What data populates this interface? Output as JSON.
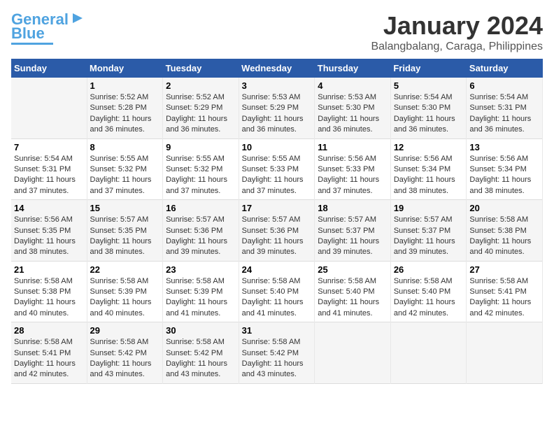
{
  "logo": {
    "line1": "General",
    "line2": "Blue"
  },
  "title": "January 2024",
  "subtitle": "Balangbalang, Caraga, Philippines",
  "days_of_week": [
    "Sunday",
    "Monday",
    "Tuesday",
    "Wednesday",
    "Thursday",
    "Friday",
    "Saturday"
  ],
  "weeks": [
    [
      {
        "day": "",
        "info": ""
      },
      {
        "day": "1",
        "info": "Sunrise: 5:52 AM\nSunset: 5:28 PM\nDaylight: 11 hours\nand 36 minutes."
      },
      {
        "day": "2",
        "info": "Sunrise: 5:52 AM\nSunset: 5:29 PM\nDaylight: 11 hours\nand 36 minutes."
      },
      {
        "day": "3",
        "info": "Sunrise: 5:53 AM\nSunset: 5:29 PM\nDaylight: 11 hours\nand 36 minutes."
      },
      {
        "day": "4",
        "info": "Sunrise: 5:53 AM\nSunset: 5:30 PM\nDaylight: 11 hours\nand 36 minutes."
      },
      {
        "day": "5",
        "info": "Sunrise: 5:54 AM\nSunset: 5:30 PM\nDaylight: 11 hours\nand 36 minutes."
      },
      {
        "day": "6",
        "info": "Sunrise: 5:54 AM\nSunset: 5:31 PM\nDaylight: 11 hours\nand 36 minutes."
      }
    ],
    [
      {
        "day": "7",
        "info": "Sunrise: 5:54 AM\nSunset: 5:31 PM\nDaylight: 11 hours\nand 37 minutes."
      },
      {
        "day": "8",
        "info": "Sunrise: 5:55 AM\nSunset: 5:32 PM\nDaylight: 11 hours\nand 37 minutes."
      },
      {
        "day": "9",
        "info": "Sunrise: 5:55 AM\nSunset: 5:32 PM\nDaylight: 11 hours\nand 37 minutes."
      },
      {
        "day": "10",
        "info": "Sunrise: 5:55 AM\nSunset: 5:33 PM\nDaylight: 11 hours\nand 37 minutes."
      },
      {
        "day": "11",
        "info": "Sunrise: 5:56 AM\nSunset: 5:33 PM\nDaylight: 11 hours\nand 37 minutes."
      },
      {
        "day": "12",
        "info": "Sunrise: 5:56 AM\nSunset: 5:34 PM\nDaylight: 11 hours\nand 38 minutes."
      },
      {
        "day": "13",
        "info": "Sunrise: 5:56 AM\nSunset: 5:34 PM\nDaylight: 11 hours\nand 38 minutes."
      }
    ],
    [
      {
        "day": "14",
        "info": "Sunrise: 5:56 AM\nSunset: 5:35 PM\nDaylight: 11 hours\nand 38 minutes."
      },
      {
        "day": "15",
        "info": "Sunrise: 5:57 AM\nSunset: 5:35 PM\nDaylight: 11 hours\nand 38 minutes."
      },
      {
        "day": "16",
        "info": "Sunrise: 5:57 AM\nSunset: 5:36 PM\nDaylight: 11 hours\nand 39 minutes."
      },
      {
        "day": "17",
        "info": "Sunrise: 5:57 AM\nSunset: 5:36 PM\nDaylight: 11 hours\nand 39 minutes."
      },
      {
        "day": "18",
        "info": "Sunrise: 5:57 AM\nSunset: 5:37 PM\nDaylight: 11 hours\nand 39 minutes."
      },
      {
        "day": "19",
        "info": "Sunrise: 5:57 AM\nSunset: 5:37 PM\nDaylight: 11 hours\nand 39 minutes."
      },
      {
        "day": "20",
        "info": "Sunrise: 5:58 AM\nSunset: 5:38 PM\nDaylight: 11 hours\nand 40 minutes."
      }
    ],
    [
      {
        "day": "21",
        "info": "Sunrise: 5:58 AM\nSunset: 5:38 PM\nDaylight: 11 hours\nand 40 minutes."
      },
      {
        "day": "22",
        "info": "Sunrise: 5:58 AM\nSunset: 5:39 PM\nDaylight: 11 hours\nand 40 minutes."
      },
      {
        "day": "23",
        "info": "Sunrise: 5:58 AM\nSunset: 5:39 PM\nDaylight: 11 hours\nand 41 minutes."
      },
      {
        "day": "24",
        "info": "Sunrise: 5:58 AM\nSunset: 5:40 PM\nDaylight: 11 hours\nand 41 minutes."
      },
      {
        "day": "25",
        "info": "Sunrise: 5:58 AM\nSunset: 5:40 PM\nDaylight: 11 hours\nand 41 minutes."
      },
      {
        "day": "26",
        "info": "Sunrise: 5:58 AM\nSunset: 5:40 PM\nDaylight: 11 hours\nand 42 minutes."
      },
      {
        "day": "27",
        "info": "Sunrise: 5:58 AM\nSunset: 5:41 PM\nDaylight: 11 hours\nand 42 minutes."
      }
    ],
    [
      {
        "day": "28",
        "info": "Sunrise: 5:58 AM\nSunset: 5:41 PM\nDaylight: 11 hours\nand 42 minutes."
      },
      {
        "day": "29",
        "info": "Sunrise: 5:58 AM\nSunset: 5:42 PM\nDaylight: 11 hours\nand 43 minutes."
      },
      {
        "day": "30",
        "info": "Sunrise: 5:58 AM\nSunset: 5:42 PM\nDaylight: 11 hours\nand 43 minutes."
      },
      {
        "day": "31",
        "info": "Sunrise: 5:58 AM\nSunset: 5:42 PM\nDaylight: 11 hours\nand 43 minutes."
      },
      {
        "day": "",
        "info": ""
      },
      {
        "day": "",
        "info": ""
      },
      {
        "day": "",
        "info": ""
      }
    ]
  ]
}
